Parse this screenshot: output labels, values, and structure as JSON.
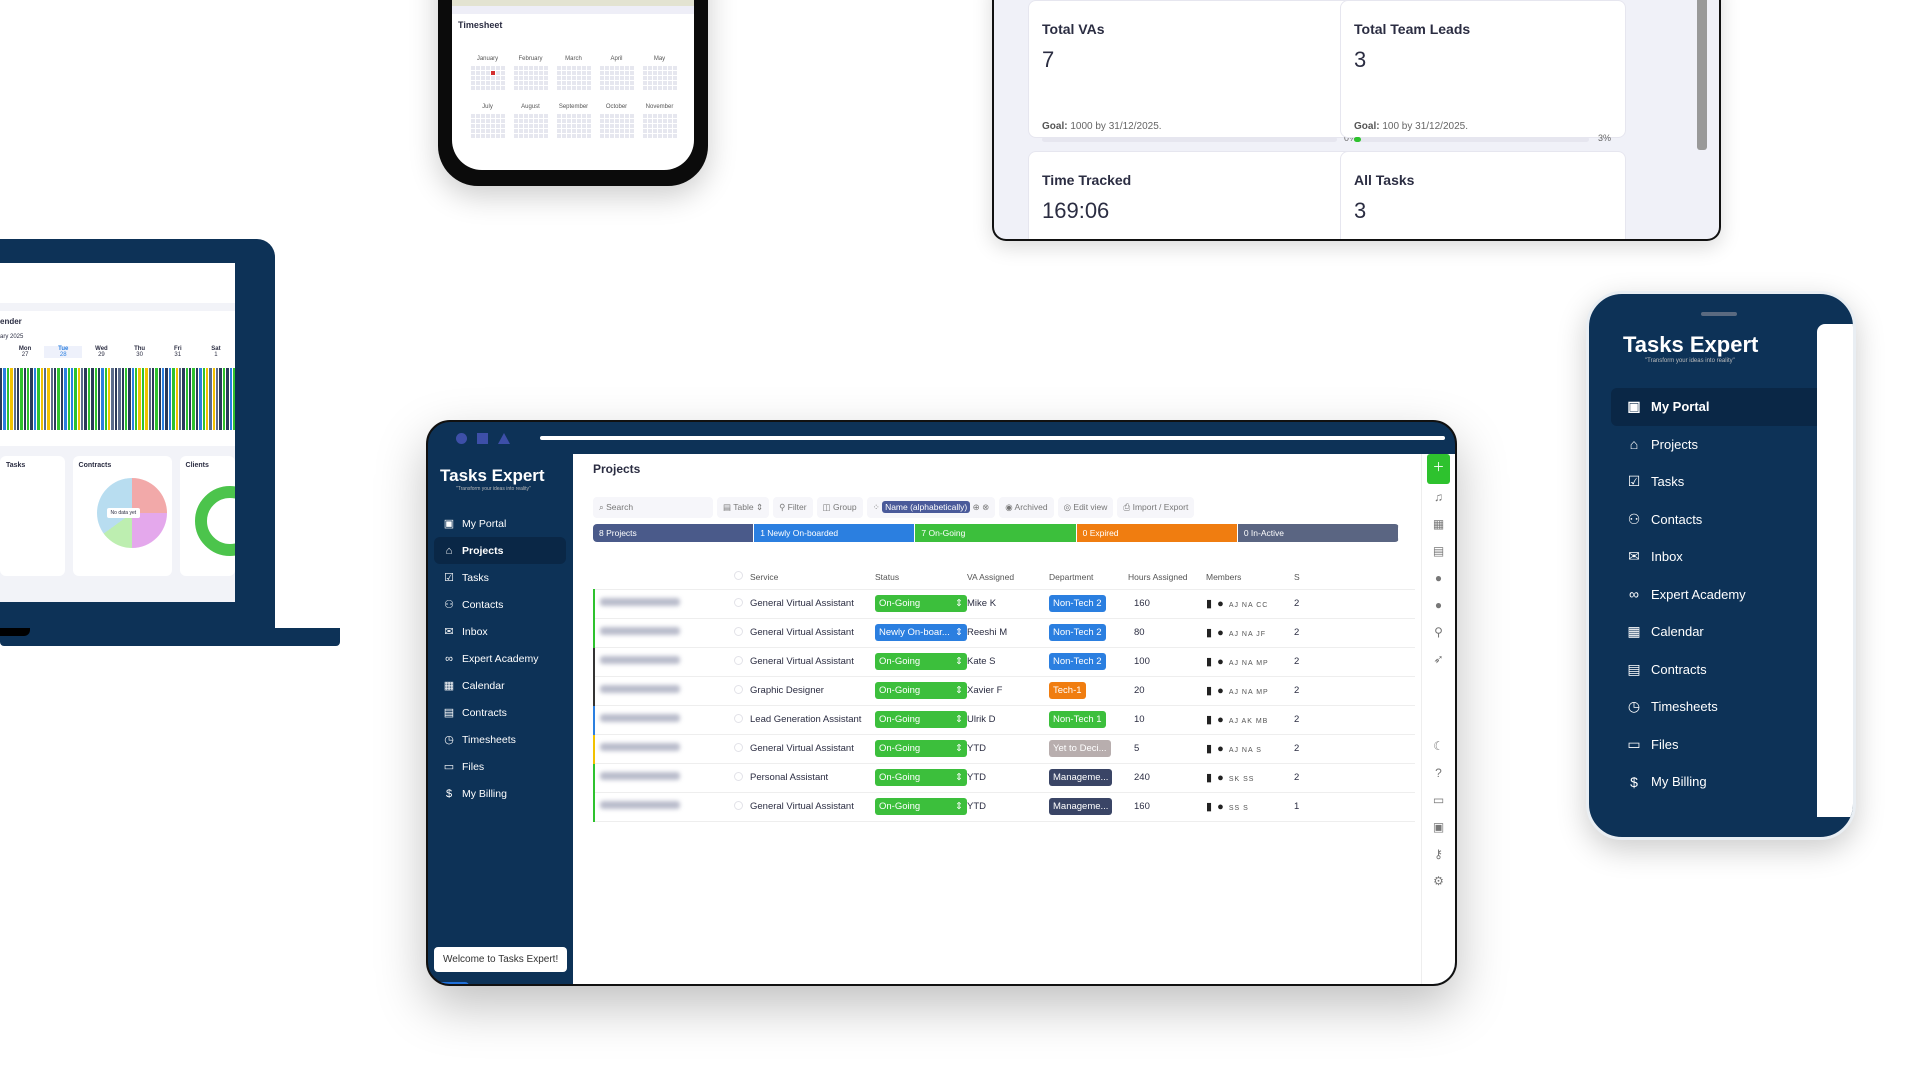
{
  "timesheet_phone": {
    "title": "Timesheet",
    "months": [
      "January",
      "February",
      "March",
      "April",
      "May",
      "July",
      "August",
      "September",
      "October",
      "November"
    ]
  },
  "stats": {
    "cards": [
      {
        "title": "Total VAs",
        "value": "7",
        "goal_label": "Goal:",
        "goal": "1000 by 31/12/2025.",
        "percent": 0,
        "percent_label": "0%"
      },
      {
        "title": "Total Team Leads",
        "value": "3",
        "goal_label": "Goal:",
        "goal": "100 by 31/12/2025.",
        "percent": 3,
        "percent_label": "3%"
      },
      {
        "title": "Time Tracked",
        "value": "169:06"
      },
      {
        "title": "All Tasks",
        "value": "3"
      }
    ]
  },
  "laptop": {
    "calendar_title": "ender",
    "month": "ary 2025",
    "days": [
      [
        "Mon",
        "27"
      ],
      [
        "Tue",
        "28"
      ],
      [
        "Wed",
        "29"
      ],
      [
        "Thu",
        "30"
      ],
      [
        "Fri",
        "31"
      ],
      [
        "Sat",
        "1"
      ]
    ],
    "widgets": [
      "Tasks",
      "Contracts",
      "Clients"
    ],
    "no_data": "No data yet",
    "bar_colors": [
      "#2ec22e",
      "#2b3a5a",
      "#f2c200",
      "#2b7fe0",
      "#5b6c8a"
    ]
  },
  "app": {
    "brand": "Tasks Expert",
    "tagline": "\"Transform your ideas into reality\"",
    "nav": [
      {
        "label": "My Portal",
        "icon": "portal-icon",
        "g": "▣"
      },
      {
        "label": "Projects",
        "icon": "briefcase-icon",
        "g": "⌂",
        "active": true
      },
      {
        "label": "Tasks",
        "icon": "checkbox-icon",
        "g": "☑"
      },
      {
        "label": "Contacts",
        "icon": "contacts-icon",
        "g": "⚇"
      },
      {
        "label": "Inbox",
        "icon": "inbox-icon",
        "g": "✉"
      },
      {
        "label": "Expert Academy",
        "icon": "link-icon",
        "g": "∞"
      },
      {
        "label": "Calendar",
        "icon": "calendar-icon",
        "g": "▦"
      },
      {
        "label": "Contracts",
        "icon": "contract-icon",
        "g": "▤"
      },
      {
        "label": "Timesheets",
        "icon": "clock-icon",
        "g": "◷"
      },
      {
        "label": "Files",
        "icon": "folder-icon",
        "g": "▭"
      },
      {
        "label": "My Billing",
        "icon": "dollar-icon",
        "g": "$"
      }
    ],
    "welcome": "Welcome to Tasks Expert!"
  },
  "projects": {
    "title": "Projects",
    "toolbar": {
      "search": "Search",
      "table": "Table",
      "filter": "Filter",
      "group": "Group",
      "sort": "Name (alphabetically)",
      "archived": "Archived",
      "edit_view": "Edit view",
      "import_export": "Import / Export"
    },
    "summary": [
      {
        "label": "8  Projects",
        "color": "#4a5a8a"
      },
      {
        "label": "1  Newly On-boarded",
        "color": "#2b7fe0"
      },
      {
        "label": "7  On-Going",
        "color": "#3cbf3c"
      },
      {
        "label": "0  Expired",
        "color": "#f07d10"
      },
      {
        "label": "0  In-Active",
        "color": "#5a6582"
      }
    ],
    "columns": [
      "Service",
      "Status",
      "VA Assigned",
      "Department",
      "Hours Assigned",
      "Members"
    ],
    "rows": [
      {
        "service": "General Virtual Assistant",
        "status": "On-Going",
        "va": "Mike K",
        "dept": "Non-Tech 2",
        "hours": "160",
        "members": "AJ NA CC",
        "s": "2",
        "bar": "#2ec22e"
      },
      {
        "service": "General Virtual Assistant",
        "status": "Newly On-boar...",
        "va": "Reeshi M",
        "dept": "Non-Tech 2",
        "hours": "80",
        "members": "AJ NA JF",
        "s": "2",
        "bar": "#2ec22e"
      },
      {
        "service": "General Virtual Assistant",
        "status": "On-Going",
        "va": "Kate S",
        "dept": "Non-Tech 2",
        "hours": "100",
        "members": "AJ NA MP",
        "s": "2",
        "bar": "#333"
      },
      {
        "service": "Graphic Designer",
        "status": "On-Going",
        "va": "Xavier F",
        "dept": "Tech-1",
        "hours": "20",
        "members": "AJ NA MP",
        "s": "2",
        "bar": "#333"
      },
      {
        "service": "Lead Generation Assistant",
        "status": "On-Going",
        "va": "Ulrik D",
        "dept": "Non-Tech 1",
        "hours": "10",
        "members": "AJ AK MB",
        "s": "2",
        "bar": "#2b7fe0"
      },
      {
        "service": "General Virtual Assistant",
        "status": "On-Going",
        "va": "YTD",
        "dept": "Yet to Deci...",
        "hours": "5",
        "members": "AJ NA S",
        "s": "2",
        "bar": "#f2c200"
      },
      {
        "service": "Personal Assistant",
        "status": "On-Going",
        "va": "YTD",
        "dept": "Manageme...",
        "hours": "240",
        "members": "SK SS",
        "s": "2",
        "bar": "#2ec22e"
      },
      {
        "service": "General Virtual Assistant",
        "status": "On-Going",
        "va": "YTD",
        "dept": "Manageme...",
        "hours": "160",
        "members": "SS S",
        "s": "1",
        "bar": "#2ec22e"
      }
    ],
    "status_colors": {
      "On-Going": "#3cbf3c",
      "Newly On-boar...": "#2b7fe0"
    },
    "dept_colors": {
      "Non-Tech 2": "#2b7fe0",
      "Tech-1": "#f07d10",
      "Non-Tech 1": "#3cbf3c",
      "Yet to Deci...": "#b8aeae",
      "Manageme...": "#3a4566"
    }
  }
}
